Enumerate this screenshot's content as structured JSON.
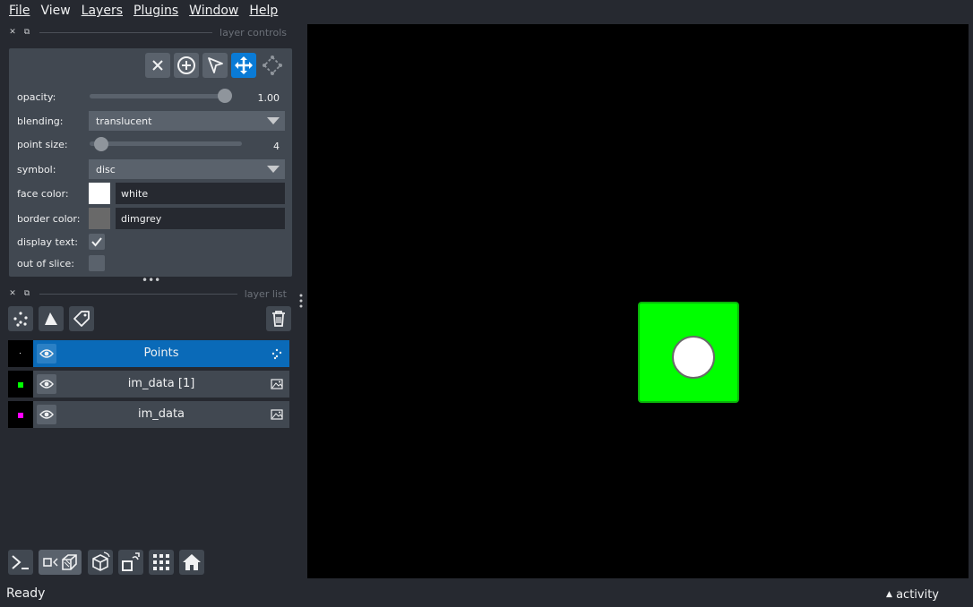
{
  "menu": [
    "File",
    "View",
    "Layers",
    "Plugins",
    "Window",
    "Help"
  ],
  "docks": {
    "controls_title": "layer controls",
    "list_title": "layer list"
  },
  "controls": {
    "opacity_label": "opacity:",
    "opacity_value": "1.00",
    "opacity_level": 1.0,
    "blending_label": "blending:",
    "blending_value": "translucent",
    "point_size_label": "point size:",
    "point_size_value": "4",
    "symbol_label": "symbol:",
    "symbol_value": "disc",
    "face_color_label": "face color:",
    "face_color_value": "white",
    "face_color_hex": "#ffffff",
    "border_color_label": "border color:",
    "border_color_value": "dimgrey",
    "border_color_hex": "#696969",
    "display_text_label": "display text:",
    "display_text_checked": true,
    "out_of_slice_label": "out of slice:",
    "out_of_slice_checked": false
  },
  "layers": [
    {
      "name": "Points",
      "type": "points",
      "selected": true,
      "thumb_color": "#ffffff"
    },
    {
      "name": "im_data [1]",
      "type": "image",
      "selected": false,
      "thumb_color": "#00ff00"
    },
    {
      "name": "im_data",
      "type": "image",
      "selected": false,
      "thumb_color": "#ff00ff"
    }
  ],
  "status": {
    "text": "Ready",
    "activity": "activity"
  },
  "colors": {
    "accent": "#0a7bd6",
    "square": "#00ff00"
  }
}
